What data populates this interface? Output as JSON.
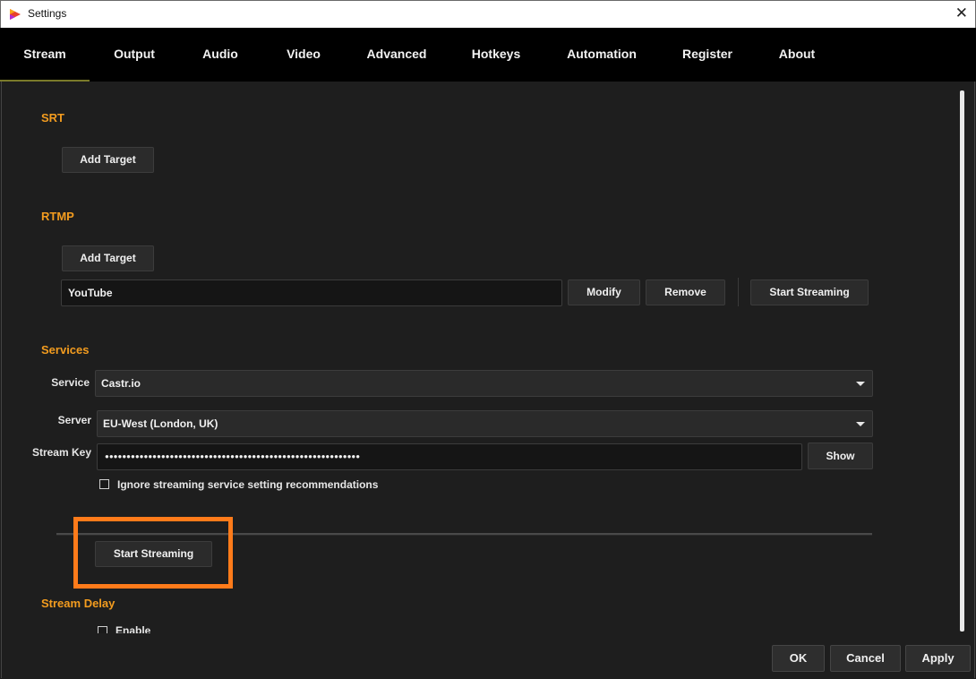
{
  "window": {
    "title": "Settings",
    "close_icon": "close-icon",
    "app_icon": "app-logo-icon"
  },
  "tabs": [
    {
      "label": "Stream",
      "active": true
    },
    {
      "label": "Output"
    },
    {
      "label": "Audio"
    },
    {
      "label": "Video"
    },
    {
      "label": "Advanced"
    },
    {
      "label": "Hotkeys"
    },
    {
      "label": "Automation"
    },
    {
      "label": "Register"
    },
    {
      "label": "About"
    }
  ],
  "srt": {
    "title": "SRT",
    "add_target": "Add Target"
  },
  "rtmp": {
    "title": "RTMP",
    "add_target": "Add Target",
    "target_value": "YouTube",
    "modify": "Modify",
    "remove": "Remove",
    "start_streaming": "Start Streaming"
  },
  "services": {
    "title": "Services",
    "service_label": "Service",
    "service_value": "Castr.io",
    "server_label": "Server",
    "server_value": "EU-West (London, UK)",
    "stream_key_label": "Stream Key",
    "stream_key_value": "●●●●●●●●●●●●●●●●●●●●●●●●●●●●●●●●●●●●●●●●●●●●●●●●●●●●●●●●●●●",
    "show": "Show",
    "ignore_label": "Ignore streaming service setting recommendations",
    "ignore_checked": false
  },
  "start_streaming_main": "Start Streaming",
  "stream_delay": {
    "title": "Stream Delay",
    "enable_label": "Enable",
    "enable_checked": false
  },
  "footer": {
    "ok": "OK",
    "cancel": "Cancel",
    "apply": "Apply"
  },
  "colors": {
    "accent": "#f39c1f",
    "highlight": "#ff7b1a",
    "tabbar": "#000000",
    "background": "#1e1e1e"
  }
}
